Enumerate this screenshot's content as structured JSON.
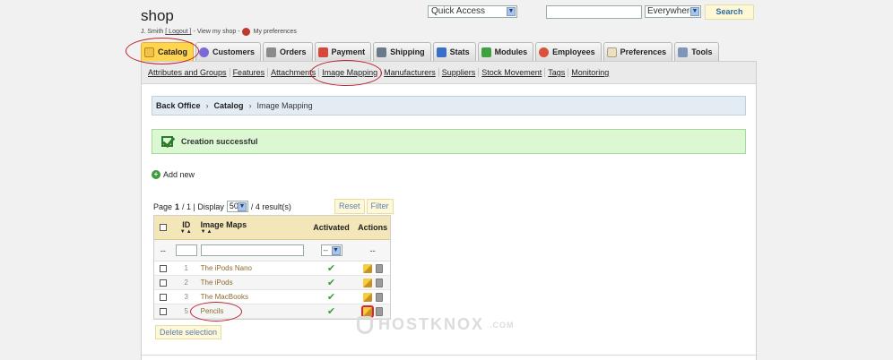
{
  "header": {
    "shop_title": "shop",
    "user_name": "J. Smith",
    "logout_label": "[ Logout ]",
    "separator1": " - ",
    "view_shop_label": "View my shop",
    "separator2": " - ",
    "my_prefs_label": "My preferences"
  },
  "search": {
    "quick_access_value": "Quick Access",
    "search_placeholder": "",
    "scope_value": "Everywhere",
    "button_label": "Search"
  },
  "tabs": [
    {
      "label": "Catalog",
      "icon": "folder-icon",
      "active": true
    },
    {
      "label": "Customers",
      "icon": "person-icon",
      "active": false
    },
    {
      "label": "Orders",
      "icon": "cart-icon",
      "active": false
    },
    {
      "label": "Payment",
      "icon": "payment-icon",
      "active": false
    },
    {
      "label": "Shipping",
      "icon": "truck-icon",
      "active": false
    },
    {
      "label": "Stats",
      "icon": "chart-icon",
      "active": false
    },
    {
      "label": "Modules",
      "icon": "puzzle-icon",
      "active": false
    },
    {
      "label": "Employees",
      "icon": "employee-icon",
      "active": false
    },
    {
      "label": "Preferences",
      "icon": "prefs-icon",
      "active": false
    },
    {
      "label": "Tools",
      "icon": "wrench-icon",
      "active": false
    }
  ],
  "subnav": [
    "Attributes and Groups",
    "Features",
    "Attachments",
    "Image Mapping",
    "Manufacturers",
    "Suppliers",
    "Stock Movement",
    "Tags",
    "Monitoring"
  ],
  "breadcrumb": {
    "root": "Back Office",
    "section": "Catalog",
    "current": "Image Mapping"
  },
  "message": {
    "success": "Creation successful"
  },
  "actions": {
    "add_new": "Add new",
    "reset": "Reset",
    "filter": "Filter",
    "delete_selection": "Delete selection"
  },
  "pagination": {
    "page_label": "Page",
    "page_current": "1",
    "page_total_text": "/ 1 | Display",
    "per_page": "50",
    "results_text": "/ 4 result(s)"
  },
  "table": {
    "headers": {
      "id": "ID",
      "name": "Image Maps",
      "activated": "Activated",
      "actions": "Actions"
    },
    "filter_placeholder_dash": "--",
    "filter_select_value": "--",
    "rows": [
      {
        "id": "1",
        "name": "The iPods Nano",
        "activated": true
      },
      {
        "id": "2",
        "name": "The iPods",
        "activated": true
      },
      {
        "id": "3",
        "name": "The MacBooks",
        "activated": true
      },
      {
        "id": "5",
        "name": "Pencils",
        "activated": true
      }
    ]
  },
  "watermark": {
    "text": "HOSTKNOX",
    "suffix": ".COM"
  },
  "colors": {
    "active_tab": "#ffd44f",
    "success_bg": "#dcf8d2",
    "annotation": "#c0212e"
  }
}
